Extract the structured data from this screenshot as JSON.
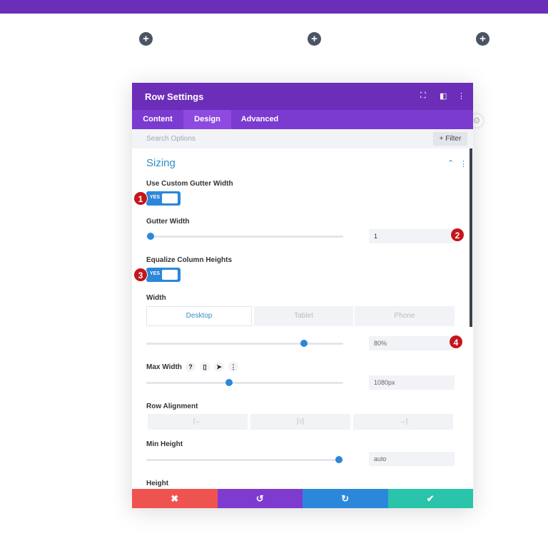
{
  "modal": {
    "title": "Row Settings",
    "tabs": [
      "Content",
      "Design",
      "Advanced"
    ],
    "active_tab": "Design",
    "search_placeholder": "Search Options",
    "filter_label": "+ Filter"
  },
  "section": {
    "title": "Sizing"
  },
  "fields": {
    "custom_gutter": {
      "label": "Use Custom Gutter Width",
      "value": "YES"
    },
    "gutter_width": {
      "label": "Gutter Width",
      "value": "1",
      "slider_fraction": 0.02
    },
    "equalize": {
      "label": "Equalize Column Heights",
      "value": "YES"
    },
    "width": {
      "label": "Width",
      "devices": [
        "Desktop",
        "Tablet",
        "Phone"
      ],
      "active_device": "Desktop",
      "value": "80%",
      "slider_fraction": 0.8
    },
    "max_width": {
      "label": "Max Width",
      "value": "1080px",
      "slider_fraction": 0.42,
      "icons": [
        "?",
        "▯",
        "➤",
        "⋮"
      ]
    },
    "row_alignment": {
      "label": "Row Alignment",
      "options": [
        "|←",
        "|↕|",
        "→|"
      ]
    },
    "min_height": {
      "label": "Min Height",
      "value": "auto",
      "slider_fraction": 0.98
    },
    "height": {
      "label": "Height"
    }
  },
  "badges": [
    "1",
    "2",
    "3",
    "4"
  ],
  "footer": {
    "cancel": "✖",
    "undo": "↺",
    "redo": "↻",
    "save": "✔"
  },
  "colors": {
    "header": "#6c2eb9",
    "accent": "#2b87da",
    "cancel": "#ef5350",
    "undo": "#7f3ad0",
    "redo": "#2b87da",
    "save": "#29c4a9"
  }
}
